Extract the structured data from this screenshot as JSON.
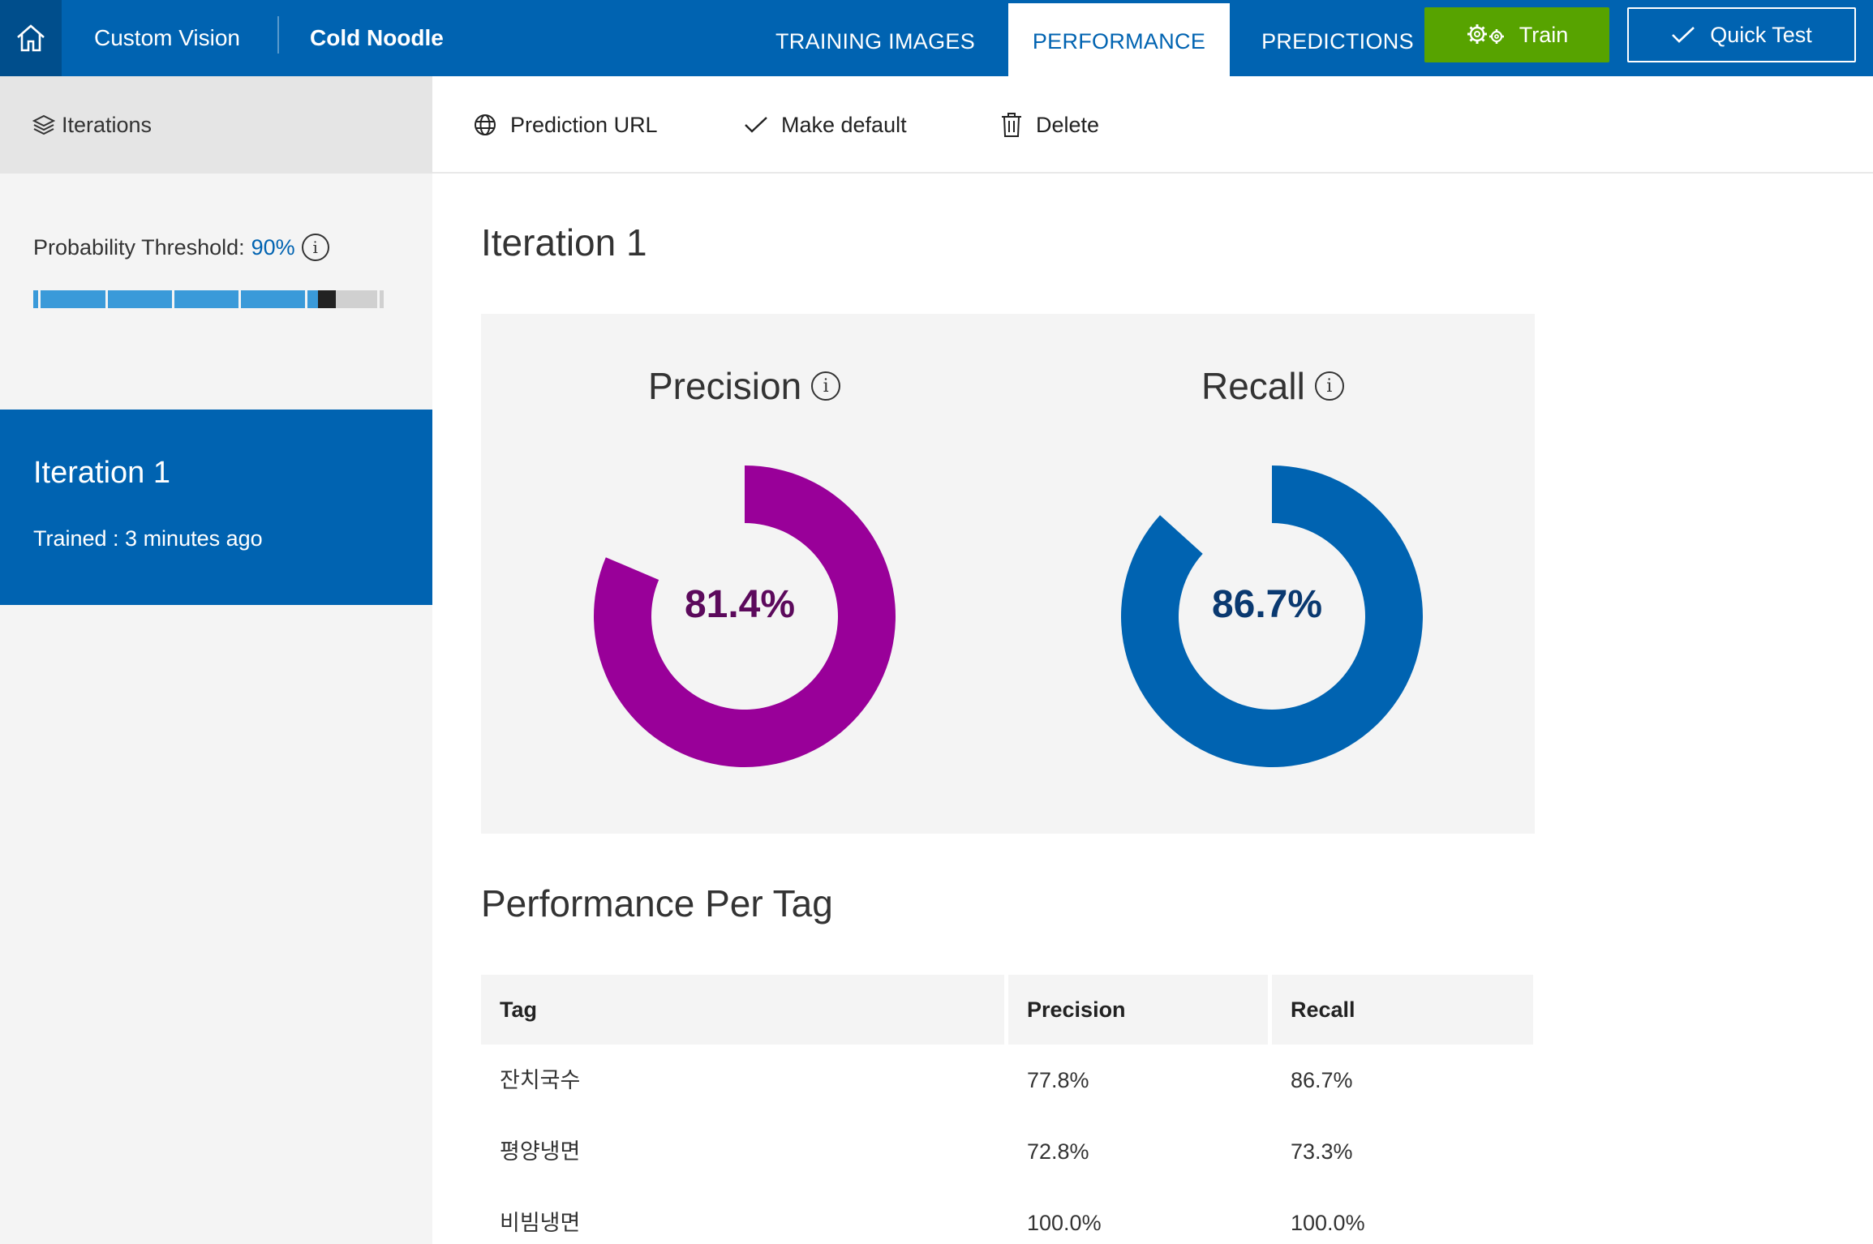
{
  "header": {
    "brand": "Custom Vision",
    "project": "Cold Noodle",
    "tabs": [
      {
        "label": "TRAINING IMAGES",
        "active": false
      },
      {
        "label": "PERFORMANCE",
        "active": true
      },
      {
        "label": "PREDICTIONS",
        "active": false
      }
    ],
    "train_label": "Train",
    "quick_test_label": "Quick Test"
  },
  "sidebar": {
    "section_label": "Iterations",
    "threshold_label": "Probability Threshold:",
    "threshold_value": "90%",
    "threshold_fraction": 0.9,
    "iterations": [
      {
        "name": "Iteration 1",
        "trained": "Trained : 3 minutes ago",
        "selected": true
      }
    ]
  },
  "toolbar": {
    "prediction_url_label": "Prediction URL",
    "make_default_label": "Make default",
    "delete_label": "Delete"
  },
  "main": {
    "title": "Iteration 1",
    "precision": {
      "label": "Precision",
      "value_text": "81.4%",
      "value": 81.4,
      "color": "#990099"
    },
    "recall": {
      "label": "Recall",
      "value_text": "86.7%",
      "value": 86.7,
      "color": "#0063b1"
    },
    "per_tag_title": "Performance Per Tag",
    "table": {
      "headers": [
        "Tag",
        "Precision",
        "Recall"
      ],
      "rows": [
        {
          "tag": "잔치국수",
          "precision": "77.8%",
          "recall": "86.7%"
        },
        {
          "tag": "평양냉면",
          "precision": "72.8%",
          "recall": "73.3%"
        },
        {
          "tag": "비빔냉면",
          "precision": "100.0%",
          "recall": "100.0%"
        }
      ]
    }
  },
  "colors": {
    "brand_blue": "#0063b1",
    "train_green": "#57a300",
    "precision_purple": "#990099"
  }
}
